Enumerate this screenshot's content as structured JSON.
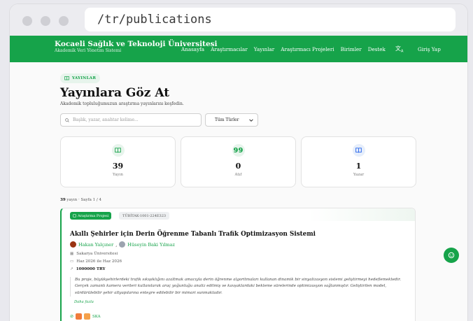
{
  "browser": {
    "url": "/tr/publications"
  },
  "navbar": {
    "brand_title": "Kocaeli Sağlık ve Teknoloji Üniversitesi",
    "brand_subtitle": "Akademik Veri Yönetim Sistemi",
    "links": [
      "Anasayfa",
      "Araştırmacılar",
      "Yayınlar",
      "Araştırmacı Projeleri",
      "Birimler",
      "Destek"
    ],
    "translate_icon": "translate-icon",
    "login_label": "Giriş Yap",
    "color": "#16a34a"
  },
  "hero": {
    "pill": "YAYINLAR",
    "title": "Yayınlara Göz At",
    "subtitle": "Akademik topluluğumuzun araştırma yayınlarını keşfedin."
  },
  "filters": {
    "search_placeholder": "Başlık, yazar, anahtar kelime...",
    "type_select": "Tüm Türler"
  },
  "stats": [
    {
      "icon": "book-icon",
      "value": "39",
      "label": "Yayın"
    },
    {
      "icon": "quote-icon",
      "value": "0",
      "label": "Atıf"
    },
    {
      "icon": "book-open-icon",
      "value": "1",
      "label": "Yazar"
    }
  ],
  "results": {
    "count": "39",
    "text": "yayın · Sayfa 1 / 4"
  },
  "card": {
    "badge": "Araştırma Projesi",
    "code": "TÜBİTAK-1001-224E323",
    "title": "Akıllı Şehirler için Derin Öğrenme Tabanlı Trafik Optimizasyon Sistemi",
    "authors": [
      "Hakan Yalçıner",
      "Hüseyin Baki Yılmaz"
    ],
    "author_separator": ",",
    "institution": "Sakarya Üniversitesi",
    "dates": "Haz 2026 ile Haz 2026",
    "budget": "1000000 TRY",
    "abstract": "Bu proje, büyükşehirlerdeki trafik sıkışıklığını azaltmak amacıyla derin öğrenme algoritmaları kullanan dinamik bir sinyalizasyon sistemi geliştirmeyi hedeflemektedir. Gerçek zamanlı kamera verileri kullanılarak araç yoğunluğu analiz edilmiş ve kavşaklardaki bekleme sürelerinde optimizasyon sağlanmıştır. Geliştirilen model, sürdürülebilir şehir altyapılarına entegre edilebilir bir mimari sunmaktadır.",
    "more": "Daha fazla",
    "footer_label": "SKA"
  }
}
